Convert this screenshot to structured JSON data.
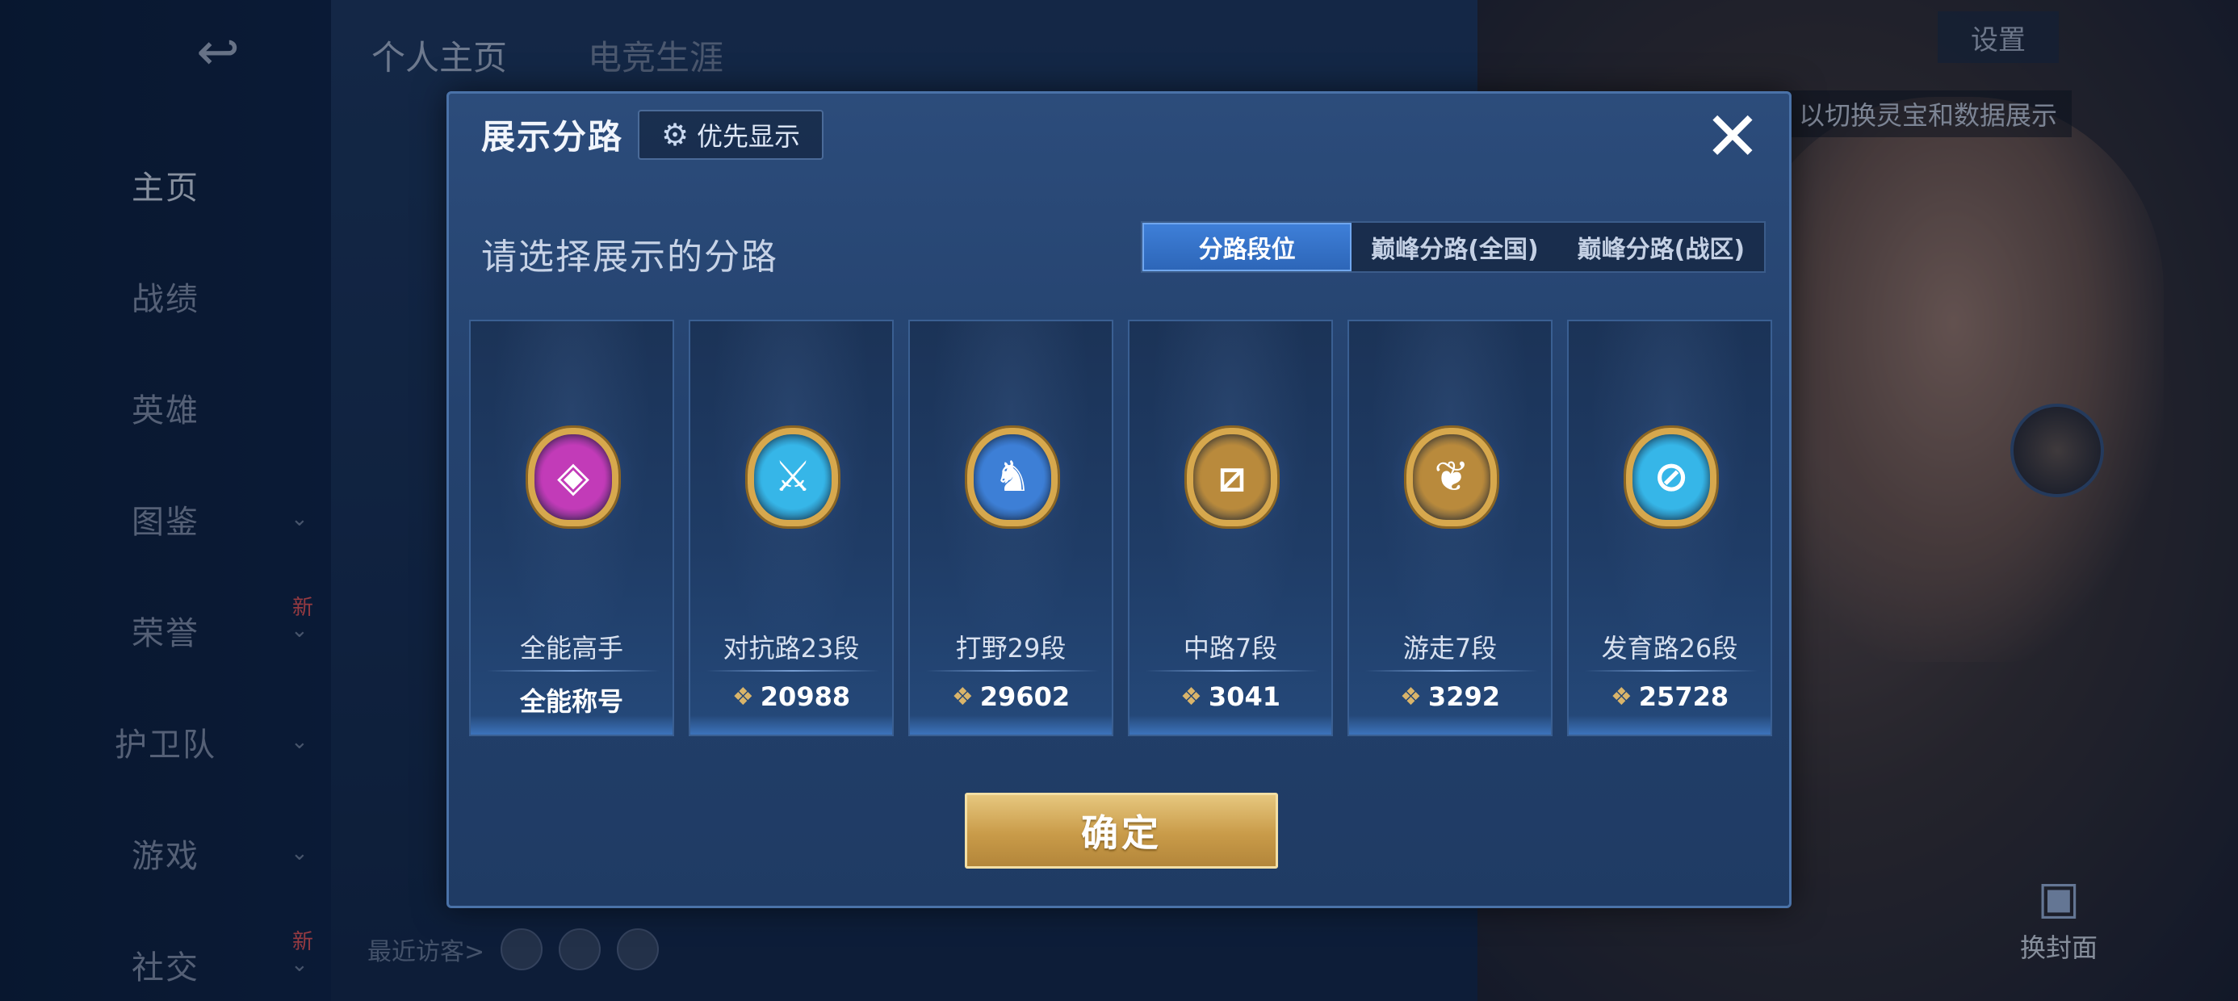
{
  "background": {
    "back_icon": "↩",
    "side_menu": [
      {
        "label": "主页",
        "active": true
      },
      {
        "label": "战绩"
      },
      {
        "label": "英雄"
      },
      {
        "label": "图鉴",
        "chevron": "⌄"
      },
      {
        "label": "荣誉",
        "chevron": "⌄",
        "badge": "新"
      },
      {
        "label": "护卫队",
        "chevron": "⌄"
      },
      {
        "label": "游戏",
        "chevron": "⌄"
      },
      {
        "label": "社交",
        "chevron": "⌄",
        "badge": "新"
      }
    ],
    "top_tabs": [
      "个人主页",
      "电竞生涯"
    ],
    "recent_visitors_label": "最近访客>",
    "settings_label": "设置",
    "hint_text": "以切换灵宝和数据展示",
    "change_cover_label": "换封面"
  },
  "modal": {
    "title": "展示分路",
    "priority_button_label": "优先显示",
    "close_icon": "✕",
    "subtitle": "请选择展示的分路",
    "tabs": [
      {
        "label": "分路段位",
        "active": true
      },
      {
        "label": "巅峰分路(全国)"
      },
      {
        "label": "巅峰分路(战区)"
      }
    ],
    "cards": [
      {
        "name": "全能高手",
        "score": "全能称号",
        "has_points": false,
        "icon": "all-round-badge-icon",
        "color": "#c23bb8",
        "glyph": "◈"
      },
      {
        "name": "对抗路23段",
        "score": "20988",
        "has_points": true,
        "icon": "clash-lane-badge-icon",
        "color": "#36b6e8",
        "glyph": "⚔"
      },
      {
        "name": "打野29段",
        "score": "29602",
        "has_points": true,
        "icon": "jungle-badge-icon",
        "color": "#3d7fd6",
        "glyph": "♞"
      },
      {
        "name": "中路7段",
        "score": "3041",
        "has_points": true,
        "icon": "mid-lane-badge-icon",
        "color": "#b98a3c",
        "glyph": "⧄"
      },
      {
        "name": "游走7段",
        "score": "3292",
        "has_points": true,
        "icon": "roam-badge-icon",
        "color": "#b98a3c",
        "glyph": "❦"
      },
      {
        "name": "发育路26段",
        "score": "25728",
        "has_points": true,
        "icon": "farm-lane-badge-icon",
        "color": "#36b6e8",
        "glyph": "⊘"
      }
    ],
    "points_icon": "❖",
    "confirm_label": "确定"
  }
}
